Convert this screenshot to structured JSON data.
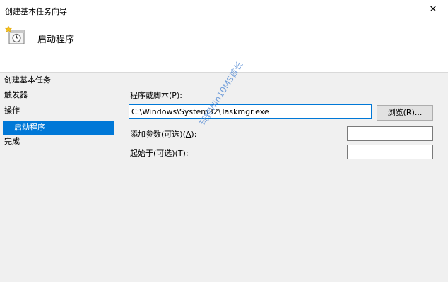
{
  "window": {
    "title": "创建基本任务向导",
    "close_glyph": "✕"
  },
  "header": {
    "title": "启动程序",
    "icon": "task-scheduler-icon"
  },
  "nav": {
    "items": [
      {
        "label": "创建基本任务",
        "selected": false
      },
      {
        "label": "触发器",
        "selected": false
      },
      {
        "label": "操作",
        "selected": false
      },
      {
        "label": "启动程序",
        "selected": true
      },
      {
        "label": "完成",
        "selected": false
      }
    ]
  },
  "form": {
    "program_label": "程序或脚本(",
    "program_key": "P",
    "program_label_end": "):",
    "program_value": "C:\\Windows\\System32\\Taskmgr.exe",
    "browse_label_pre": "浏览(",
    "browse_key": "R",
    "browse_label_post": ")...",
    "args_label": "添加参数(可选)(",
    "args_key": "A",
    "args_label_end": "):",
    "args_value": "",
    "startin_label": "起始于(可选)(",
    "startin_key": "T",
    "startin_label_end": "):",
    "startin_value": ""
  },
  "watermark": "玩转Win10MS首长",
  "colors": {
    "selection": "#0078d7",
    "panel_bg": "#f0f0f0",
    "accent_border": "#0078d7"
  }
}
